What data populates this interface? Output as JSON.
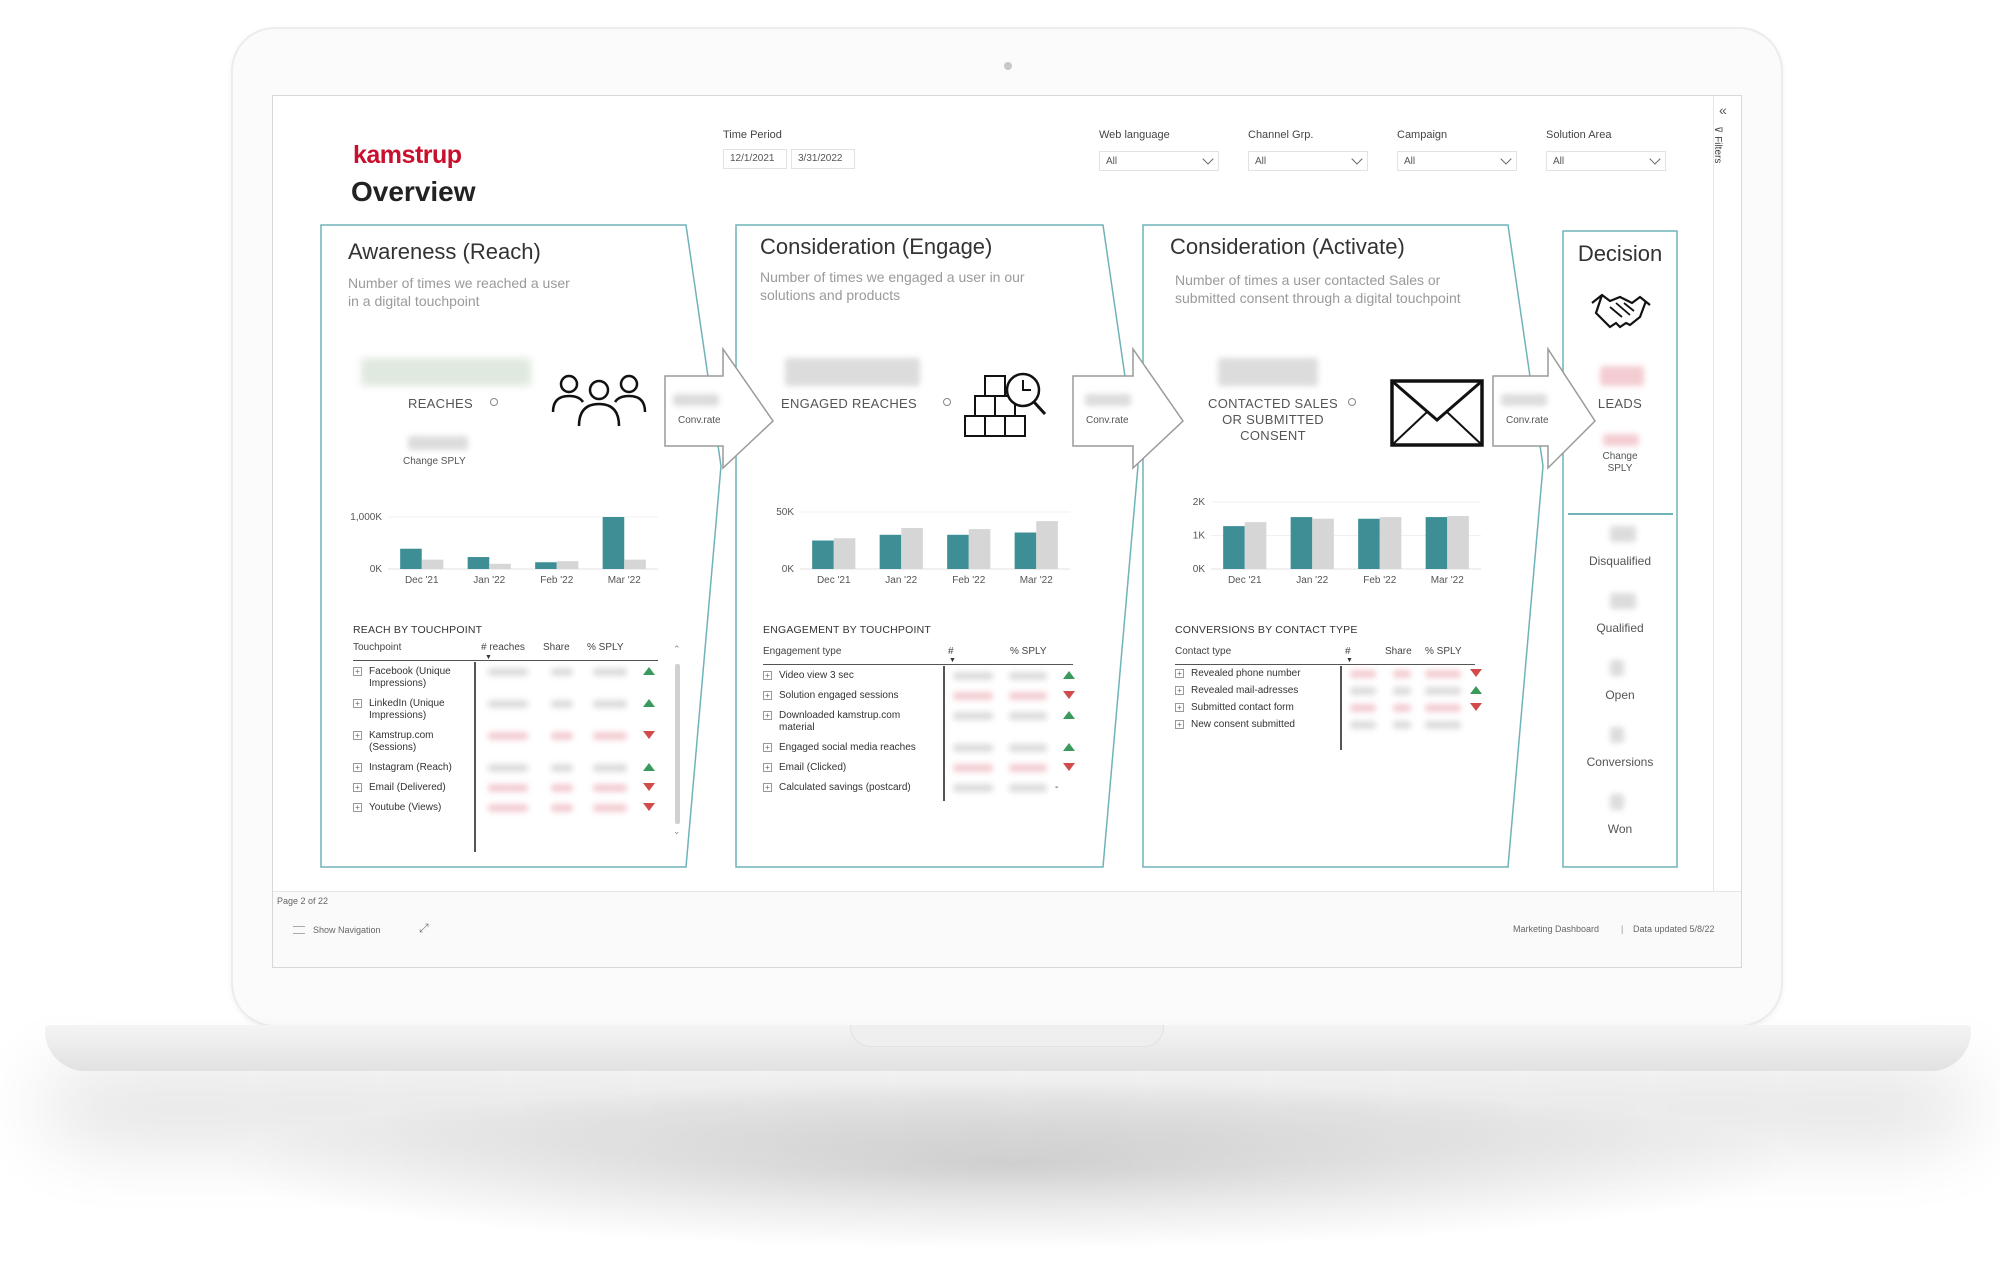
{
  "header": {
    "logo_text": "kamstrup",
    "title": "Overview"
  },
  "filters": {
    "time_period": {
      "label": "Time Period",
      "start": "12/1/2021",
      "end": "3/31/2022"
    },
    "web_language": {
      "label": "Web language",
      "value": "All"
    },
    "channel_grp": {
      "label": "Channel Grp.",
      "value": "All"
    },
    "campaign": {
      "label": "Campaign",
      "value": "All"
    },
    "solution_area": {
      "label": "Solution Area",
      "value": "All"
    },
    "pane_label": "Filters"
  },
  "stages": {
    "reach": {
      "title": "Awareness (Reach)",
      "desc1": "Number of times we reached a user",
      "desc2": "in a digital touchpoint",
      "kpi_label": "REACHES",
      "change_label": "Change SPLY",
      "section_title": "REACH BY TOUCHPOINT",
      "table_headers": [
        "Touchpoint",
        "# reaches",
        "Share",
        "% SPLY"
      ],
      "rows": [
        {
          "l1": "Facebook (Unique",
          "l2": "Impressions)",
          "trend": "up"
        },
        {
          "l1": "LinkedIn (Unique",
          "l2": "Impressions)",
          "trend": "up"
        },
        {
          "l1": "Kamstrup.com",
          "l2": "(Sessions)",
          "trend": "down"
        },
        {
          "l1": "Instagram (Reach)",
          "l2": "",
          "trend": "up"
        },
        {
          "l1": "Email (Delivered)",
          "l2": "",
          "trend": "down"
        },
        {
          "l1": "Youtube (Views)",
          "l2": "",
          "trend": "down"
        }
      ]
    },
    "engage": {
      "title": "Consideration (Engage)",
      "desc1": "Number of times we engaged a user in our",
      "desc2": "solutions and products",
      "kpi_label": "ENGAGED REACHES",
      "section_title": "ENGAGEMENT BY TOUCHPOINT",
      "table_headers": [
        "Engagement type",
        "#",
        "% SPLY"
      ],
      "rows": [
        {
          "l1": "Video view 3 sec",
          "l2": "",
          "trend": "up"
        },
        {
          "l1": "Solution engaged sessions",
          "l2": "",
          "trend": "down"
        },
        {
          "l1": "Downloaded kamstrup.com",
          "l2": "material",
          "trend": "up"
        },
        {
          "l1": "Engaged social media reaches",
          "l2": "",
          "trend": "up"
        },
        {
          "l1": "Email (Clicked)",
          "l2": "",
          "trend": "down"
        },
        {
          "l1": "Calculated savings (postcard)",
          "l2": "",
          "trend": "none",
          "dash": "-"
        }
      ]
    },
    "activate": {
      "title": "Consideration (Activate)",
      "desc1": "Number of times a user contacted Sales or",
      "desc2": "submitted consent through a digital touchpoint",
      "kpi_l1": "CONTACTED SALES",
      "kpi_l2": "OR SUBMITTED",
      "kpi_l3": "CONSENT",
      "section_title": "CONVERSIONS BY CONTACT TYPE",
      "table_headers": [
        "Contact type",
        "#",
        "Share",
        "% SPLY"
      ],
      "rows": [
        {
          "l1": "Revealed phone number",
          "trend": "down"
        },
        {
          "l1": "Revealed mail-adresses",
          "trend": "up"
        },
        {
          "l1": "Submitted contact form",
          "trend": "down"
        },
        {
          "l1": "New consent submitted",
          "trend": "none"
        }
      ]
    },
    "decision": {
      "title": "Decision",
      "kpi_label": "LEADS",
      "change_l1": "Change",
      "change_l2": "SPLY",
      "items": [
        "Disqualified",
        "Qualified",
        "Open",
        "Conversions",
        "Won"
      ]
    }
  },
  "arrows": {
    "conv_rate_label": "Conv.rate"
  },
  "chart_data": [
    {
      "type": "bar",
      "categories": [
        "Dec '21",
        "Jan '22",
        "Feb '22",
        "Mar '22"
      ],
      "series": [
        {
          "values": [
            390,
            230,
            130,
            1000
          ]
        },
        {
          "values": [
            180,
            100,
            150,
            180
          ]
        }
      ],
      "ylim": [
        0,
        1000
      ],
      "y_ticks": [
        "0K",
        "1,000K"
      ],
      "colors": [
        "#3d8f95",
        "#d6d6d6"
      ]
    },
    {
      "type": "bar",
      "categories": [
        "Dec '21",
        "Jan '22",
        "Feb '22",
        "Mar '22"
      ],
      "series": [
        {
          "values": [
            25,
            30,
            30,
            32
          ]
        },
        {
          "values": [
            27,
            36,
            35,
            42
          ]
        }
      ],
      "ylim": [
        0,
        50
      ],
      "y_ticks": [
        "0K",
        "50K"
      ],
      "colors": [
        "#3d8f95",
        "#d6d6d6"
      ]
    },
    {
      "type": "bar",
      "categories": [
        "Dec '21",
        "Jan '22",
        "Feb '22",
        "Mar '22"
      ],
      "series": [
        {
          "values": [
            1280,
            1550,
            1500,
            1550
          ]
        },
        {
          "values": [
            1400,
            1500,
            1550,
            1580
          ]
        }
      ],
      "ylim": [
        0,
        2000
      ],
      "y_ticks": [
        "0K",
        "1K",
        "2K"
      ],
      "colors": [
        "#3d8f95",
        "#d6d6d6"
      ]
    }
  ],
  "footer": {
    "page": "Page 2 of 22",
    "show_nav": "Show Navigation",
    "dashboard": "Marketing Dashboard",
    "updated": "Data updated 5/8/22"
  }
}
